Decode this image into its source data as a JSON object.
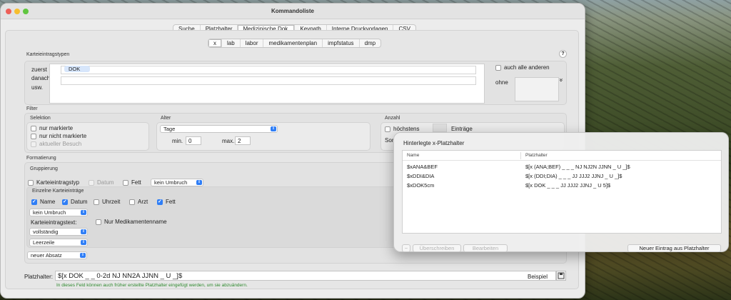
{
  "window": {
    "title": "Kommandoliste"
  },
  "top_tabs": {
    "items": [
      "Suche",
      "Platzhalter",
      "Medizinische Dok.",
      "Keypath",
      "Interne Druckvorlagen",
      "CSV"
    ],
    "selected": 2
  },
  "sub_tabs": {
    "items": [
      "x",
      "lab",
      "labor",
      "medikamentenplan",
      "impfstatus",
      "dmp"
    ],
    "selected": 0
  },
  "karteieintragstypen": {
    "title": "Karteieintragstypen",
    "help": "?",
    "labels": [
      "zuerst",
      "danach",
      "usw."
    ],
    "token": "DOK",
    "auch_alle_anderen": "auch alle anderen",
    "ohne": "ohne",
    "chevron": "»"
  },
  "filter": {
    "title": "Filter",
    "selektion": {
      "title": "Selektion",
      "options": [
        "nur markierte",
        "nur nicht markierte",
        "aktueller Besuch"
      ]
    },
    "alter": {
      "title": "Alter",
      "popup": "Tage",
      "min_label": "min.",
      "min_value": "0",
      "max_label": "max.",
      "max_value": "2"
    },
    "anzahl": {
      "title": "Anzahl",
      "hoechstens": "höchstens",
      "eintraege": "Einträge",
      "sortierung_partial": "Sor"
    }
  },
  "formatierung": {
    "title": "Formatierung",
    "gruppierung": {
      "title": "Gruppierung",
      "karteieintragstyp": "Karteieintragstyp",
      "datum": "Datum",
      "fett": "Fett",
      "umbruch": "kein Umbruch"
    },
    "einzelne": {
      "title": "Einzelne Karteieinträge",
      "name": "Name",
      "datum": "Datum",
      "uhrzeit": "Uhrzeit",
      "arzt": "Arzt",
      "fett": "Fett",
      "umbruch": "kein Umbruch",
      "karteieintragstext_label": "Karteieintragstext:",
      "nur_med": "Nur Medikamentenname",
      "text_popup": "vollständig",
      "zeile_popup": "Leerzeile"
    },
    "absatz_popup": "neuer Absatz"
  },
  "platzhalter": {
    "label": "Platzhalter:",
    "value": "$[x DOK _ _ 0-2d NJ NN2A JJNN _ U _]$",
    "beispiel": "Beispiel",
    "hint": "In dieses Feld können auch früher erstellte Platzhalter eingefügt werden, um sie abzuändern."
  },
  "popover": {
    "title": "Hinterlegte x-Platzhalter",
    "columns": [
      "Name",
      "Platzhalter"
    ],
    "rows": [
      {
        "name": "$xANA&BEF",
        "value": "$[x (ANA;BEF) _ _ _ NJ NJ2N JJNN _ U _]$"
      },
      {
        "name": "$xDDI&DIA",
        "value": "$[x (DDI;DIA) _ _ _ JJ JJJ2 JJNJ _ U _]$"
      },
      {
        "name": "$xDOK5cm",
        "value": "$[x DOK _ _ _ JJ JJJ2 JJNJ _ U 5]$"
      }
    ],
    "minus": "−",
    "ueberschreiben": "Überschreiben",
    "bearbeiten": "Bearbeiten",
    "neuer_eintrag": "Neuer Eintrag aus Platzhalter"
  },
  "icons": {
    "save": "save-icon",
    "popup_arrow": "updown-arrow-icon"
  }
}
